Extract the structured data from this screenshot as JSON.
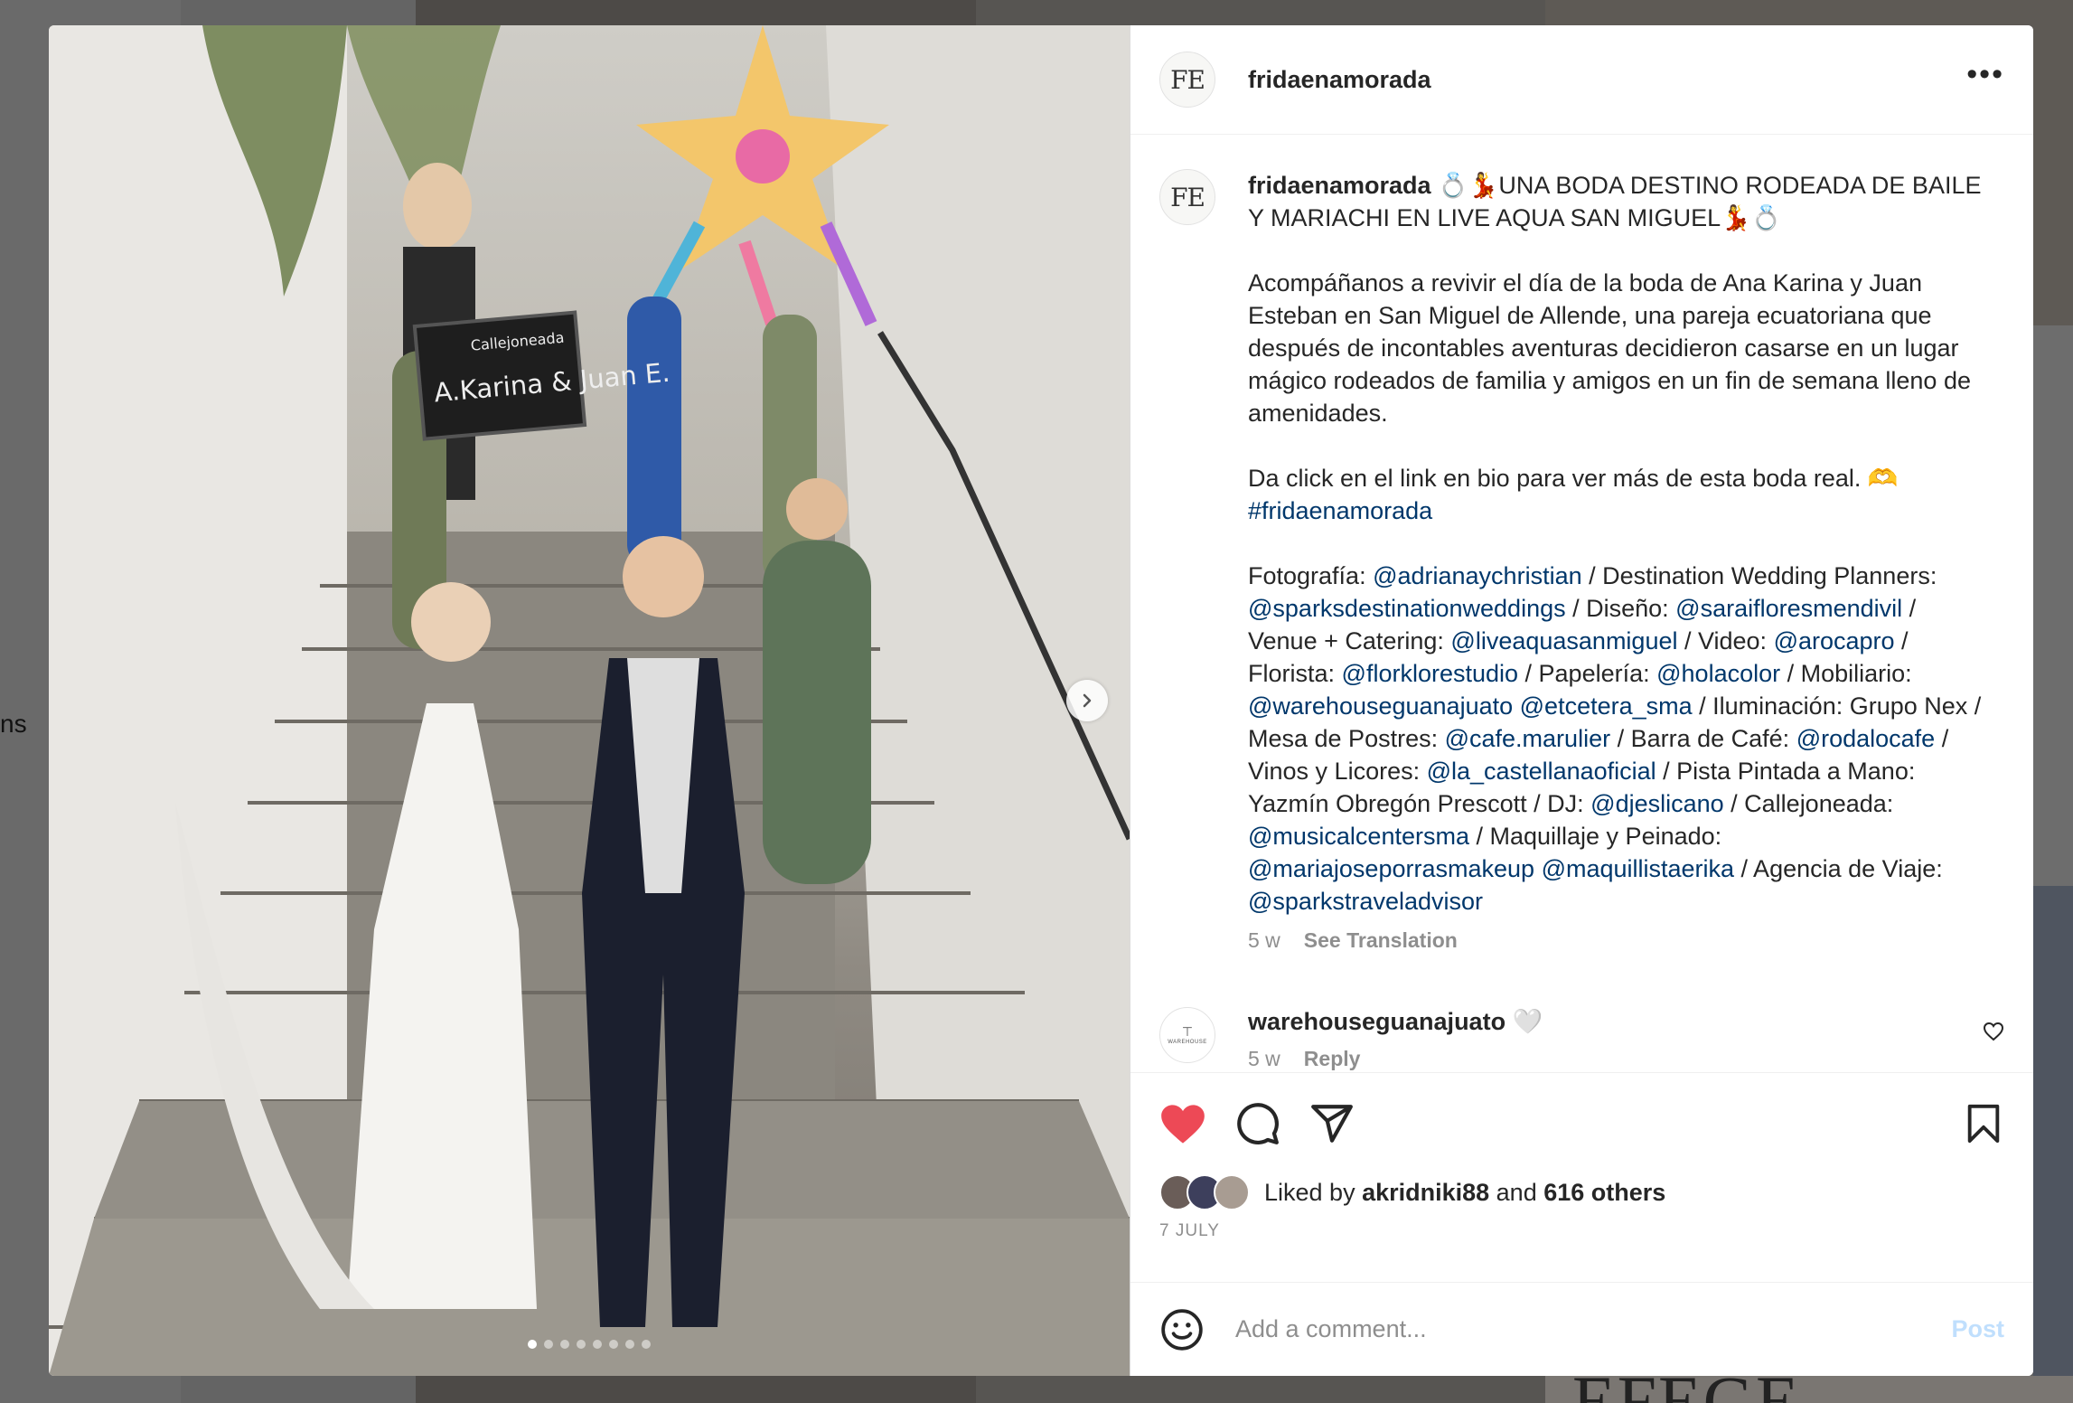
{
  "background": {
    "left_fragment": "ns",
    "right_fragment": "EFEGE"
  },
  "post": {
    "avatar_initials": "FE",
    "username": "fridaenamorada",
    "more_label": "•••",
    "photo": {
      "sign_small": "Callejoneada",
      "sign_names": "A.Karina & Juan E.",
      "dots_total": 8,
      "dots_active": 0
    },
    "caption": {
      "username": "fridaenamorada",
      "title": "💍💃UNA BODA DESTINO RODEADA DE BAILE Y MARIACHI EN LIVE AQUA SAN MIGUEL💃💍",
      "paragraph1": "Acompáñanos a revivir el día de la boda de Ana Karina y Juan Esteban en San Miguel de Allende, una pareja ecuatoriana que después de incontables aventuras decidieron casarse en un lugar mágico rodeados de familia y amigos en un fin de semana lleno de amenidades.",
      "paragraph2": "Da click en el link en bio para ver más de esta boda real. 🫶",
      "hashtag": "#fridaenamorada",
      "credits": [
        {
          "text": "Fotografía: ",
          "link": false
        },
        {
          "text": "@adrianaychristian",
          "link": true
        },
        {
          "text": " / Destination Wedding Planners: ",
          "link": false
        },
        {
          "text": "@sparksdestinationweddings",
          "link": true
        },
        {
          "text": " / Diseño: ",
          "link": false
        },
        {
          "text": "@saraifloresmendivil",
          "link": true
        },
        {
          "text": " / Venue + Catering: ",
          "link": false
        },
        {
          "text": "@liveaquasanmiguel",
          "link": true
        },
        {
          "text": " / Video: ",
          "link": false
        },
        {
          "text": "@arocapro",
          "link": true
        },
        {
          "text": " / Florista: ",
          "link": false
        },
        {
          "text": "@florklorestudio",
          "link": true
        },
        {
          "text": " / Papelería: ",
          "link": false
        },
        {
          "text": "@holacolor",
          "link": true
        },
        {
          "text": " / Mobiliario: ",
          "link": false
        },
        {
          "text": "@warehouseguanajuato",
          "link": true
        },
        {
          "text": " ",
          "link": false
        },
        {
          "text": "@etcetera_sma",
          "link": true
        },
        {
          "text": " / Iluminación: Grupo Nex / Mesa de Postres: ",
          "link": false
        },
        {
          "text": "@cafe.marulier",
          "link": true
        },
        {
          "text": " / Barra de Café: ",
          "link": false
        },
        {
          "text": "@rodalocafe",
          "link": true
        },
        {
          "text": " / Vinos y Licores: ",
          "link": false
        },
        {
          "text": "@la_castellanaoficial",
          "link": true
        },
        {
          "text": " / Pista Pintada a Mano: Yazmín Obregón Prescott / DJ: ",
          "link": false
        },
        {
          "text": "@djeslicano",
          "link": true
        },
        {
          "text": " / Callejoneada: ",
          "link": false
        },
        {
          "text": "@musicalcentersma",
          "link": true
        },
        {
          "text": " / Maquillaje y Peinado: ",
          "link": false
        },
        {
          "text": "@mariajoseporrasmakeup",
          "link": true
        },
        {
          "text": " ",
          "link": false
        },
        {
          "text": "@maquillistaerika",
          "link": true
        },
        {
          "text": " / Agencia de Viaje: ",
          "link": false
        },
        {
          "text": "@sparkstraveladvisor",
          "link": true
        }
      ],
      "age": "5 w",
      "see_translation": "See Translation"
    },
    "comment": {
      "username": "warehouseguanajuato",
      "text": "🤍",
      "age": "5 w",
      "reply": "Reply",
      "avatar_mark": "⊤",
      "avatar_word": "WAREHOUSE"
    },
    "likes": {
      "prefix": "Liked by ",
      "first_user": "akridniki88",
      "middle": " and ",
      "others": "616 others",
      "avatar_colors": [
        "#6a5d58",
        "#3d3f5c",
        "#a89c92"
      ]
    },
    "date": "7 JULY",
    "add_comment": {
      "placeholder": "Add a comment...",
      "post_label": "Post"
    },
    "colors": {
      "liked_heart": "#ed4956",
      "link": "#00376b",
      "post_disabled": "#c0dffd"
    }
  }
}
